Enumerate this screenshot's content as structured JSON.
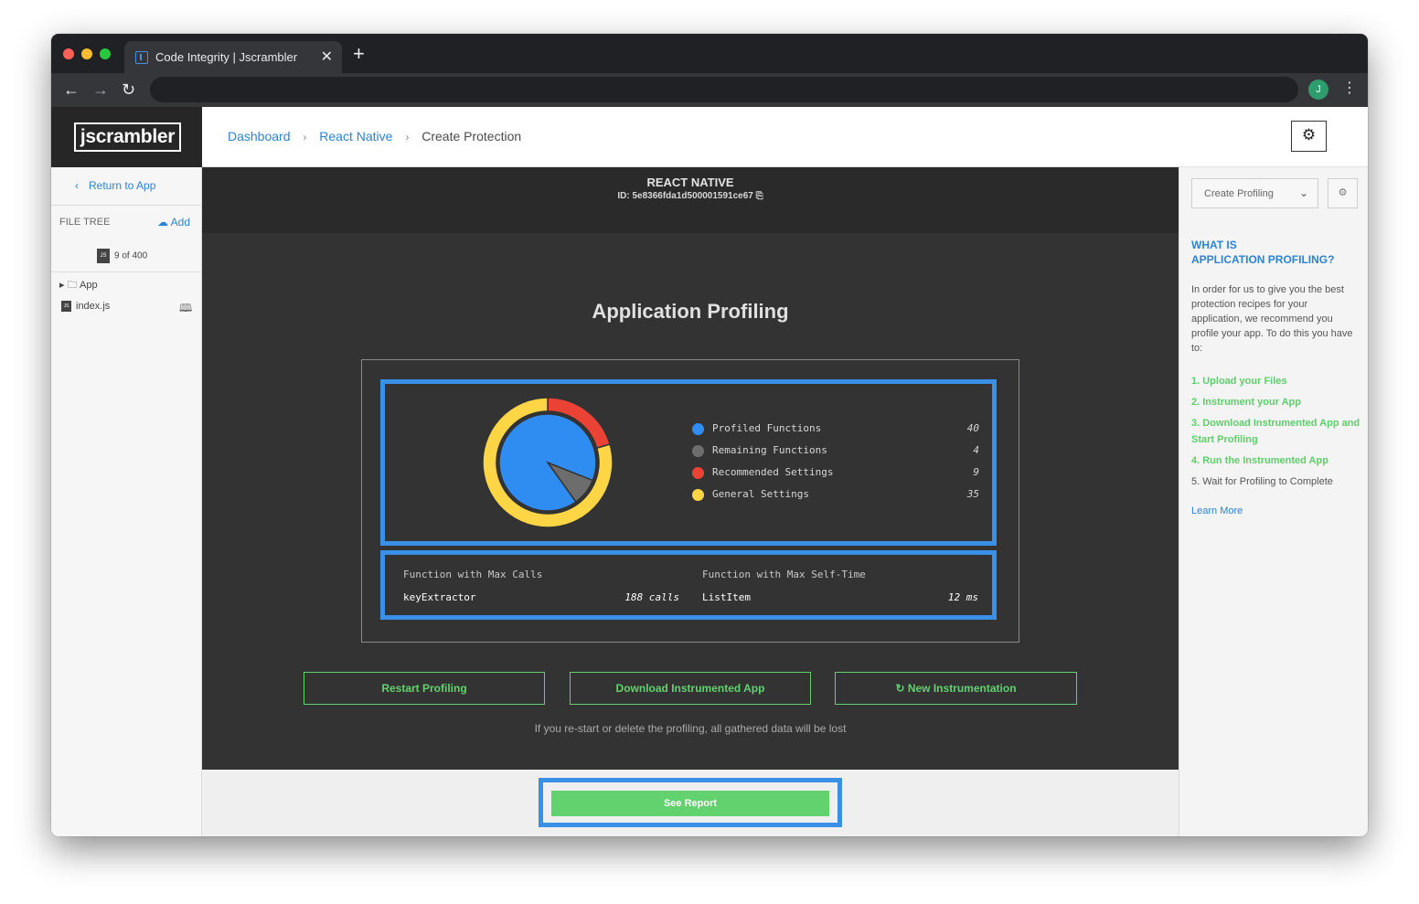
{
  "browser": {
    "tab_title": "Code Integrity | Jscrambler",
    "close_glyph": "✕",
    "new_tab_glyph": "+",
    "back_glyph": "←",
    "forward_glyph": "→",
    "reload_glyph": "↻",
    "profile_initial": "J",
    "menu_glyph": "⋮"
  },
  "header": {
    "logo": "jscrambler",
    "breadcrumb": [
      "Dashboard",
      "React Native",
      "Create Protection"
    ],
    "breadcrumb_sep": "›",
    "settings_icon": "⚙"
  },
  "sidebar": {
    "return_label": "Return to App",
    "return_glyph": "‹",
    "filetree_label": "FILE TREE",
    "add_label": "Add",
    "add_icon": "☁",
    "file_count": "9 of 400",
    "js_badge": "JS",
    "tree": [
      {
        "label": "App",
        "glyph": "▸ 🗀"
      },
      {
        "label": "index.js"
      }
    ],
    "map_icon": "🕮"
  },
  "main": {
    "app_name": "REACT NATIVE",
    "app_id": "ID: 5e8366fda1d500001591ce67",
    "copy_icon": "⎘",
    "title": "Application Profiling",
    "legend": [
      {
        "name": "Profiled Functions",
        "value": "40",
        "color": "#2f8cf0"
      },
      {
        "name": "Remaining Functions",
        "value": "4",
        "color": "#6d6d6d"
      },
      {
        "name": "Recommended Settings",
        "value": "9",
        "color": "#ea4335"
      },
      {
        "name": "General Settings",
        "value": "35",
        "color": "#fdd545"
      }
    ],
    "stats": {
      "max_calls_label": "Function with Max Calls",
      "max_calls_fn": "keyExtractor",
      "max_calls_value": "188 calls",
      "max_self_label": "Function with Max Self-Time",
      "max_self_fn": "ListItem",
      "max_self_value": "12 ms"
    },
    "buttons": {
      "restart": "Restart Profiling",
      "download": "Download Instrumented App",
      "new_instrumentation": "↻ New Instrumentation"
    },
    "warning": "If you re-start or delete the profiling, all gathered data will be lost",
    "see_report": "See Report"
  },
  "right": {
    "select_label": "Create Profiling",
    "select_chevron": "⌄",
    "gear_icon": "⚙",
    "what_is_line1": "WHAT IS",
    "what_is_line2": "APPLICATION PROFILING?",
    "intro": "In order for us to give you the best protection recipes for your application, we recommend you profile your app. To do this you have to:",
    "steps": [
      {
        "label": "1. Upload your Files",
        "done": true
      },
      {
        "label": "2. Instrument your App",
        "done": true
      },
      {
        "label": "3. Download Instrumented App and Start Profiling",
        "done": true
      },
      {
        "label": "4. Run the Instrumented App",
        "done": true
      },
      {
        "label": "5. Wait for Profiling to Complete",
        "done": false
      }
    ],
    "learn_more": "Learn More"
  },
  "chart_data": {
    "type": "pie",
    "inner": [
      {
        "name": "Profiled Functions",
        "value": 40
      },
      {
        "name": "Remaining Functions",
        "value": 4
      }
    ],
    "outer": [
      {
        "name": "Recommended Settings",
        "value": 9
      },
      {
        "name": "General Settings",
        "value": 35
      }
    ]
  },
  "colors": {
    "accent_blue": "#2d83d6",
    "highlight_blue": "#3a8fe6",
    "green": "#62d26f"
  }
}
